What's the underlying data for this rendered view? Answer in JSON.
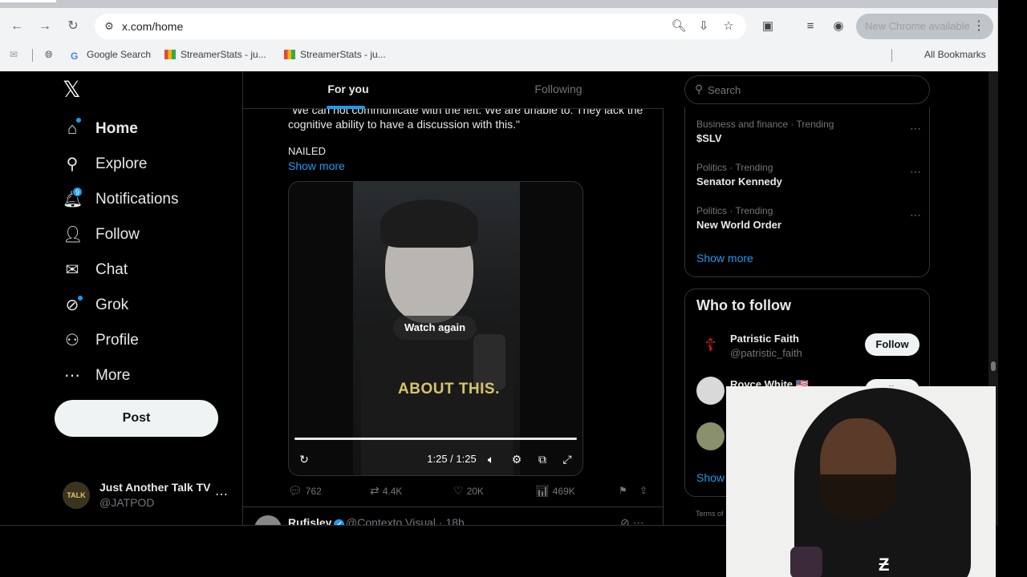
{
  "browser": {
    "url": "x.com/home",
    "update_label": "New Chrome available",
    "bookmarks": [
      {
        "label": "Google Search",
        "icon": "google-icon"
      },
      {
        "label": "StreamerStats - ju...",
        "icon": "chart-favicon"
      },
      {
        "label": "StreamerStats - ju...",
        "icon": "chart-favicon"
      }
    ],
    "all_bookmarks": "All Bookmarks"
  },
  "sidebar": {
    "items": [
      {
        "label": "Home",
        "icon": "home-icon"
      },
      {
        "label": "Explore",
        "icon": "search-icon"
      },
      {
        "label": "Notifications",
        "icon": "bell-icon",
        "badge": "9"
      },
      {
        "label": "Follow",
        "icon": "add-user-icon"
      },
      {
        "label": "Chat",
        "icon": "envelope-icon"
      },
      {
        "label": "Grok",
        "icon": "grok-icon"
      },
      {
        "label": "Profile",
        "icon": "person-icon"
      },
      {
        "label": "More",
        "icon": "more-circle-icon"
      }
    ],
    "post_label": "Post",
    "account": {
      "avatar_text": "TALK",
      "name": "Just Another Talk TV",
      "handle": "@JATPOD"
    }
  },
  "feed": {
    "tabs": [
      "For you",
      "Following"
    ],
    "tweet": {
      "text": "\"We can not communicate with the left. We are unable to. They lack the cognitive ability to have a discussion with this.\"",
      "nailed": "NAILED",
      "show_more": "Show more",
      "video": {
        "caption": "ABOUT THIS.",
        "overlay": "Watch again",
        "time": "1:25 / 1:25",
        "progress": 1.0
      },
      "actions": {
        "replies": "762",
        "reposts": "4.4K",
        "likes": "20K",
        "views": "469K"
      }
    },
    "next_tweet": {
      "name": "Rufisley",
      "handle": "@Contexto Visual · 18h"
    }
  },
  "right": {
    "search_placeholder": "Search",
    "trends": [
      {
        "meta": "Business and finance · Trending",
        "title": "$SLV"
      },
      {
        "meta": "Politics · Trending",
        "title": "Senator Kennedy"
      },
      {
        "meta": "Politics · Trending",
        "title": "New World Order"
      }
    ],
    "trends_show_more": "Show more",
    "who_to_follow": {
      "title": "Who to follow",
      "people": [
        {
          "name": "Patristic Faith",
          "handle": "@patristic_faith",
          "button": "Follow"
        },
        {
          "name": "Royce White 🇺🇸",
          "handle": "",
          "button": "Follow"
        },
        {
          "name": "",
          "handle": "",
          "button": ""
        }
      ],
      "show_more": "Show"
    },
    "terms": "Terms of"
  },
  "colors": {
    "accent": "#1d9bf0",
    "background": "#000000",
    "text": "#e7e9ea",
    "muted": "#71767b"
  }
}
